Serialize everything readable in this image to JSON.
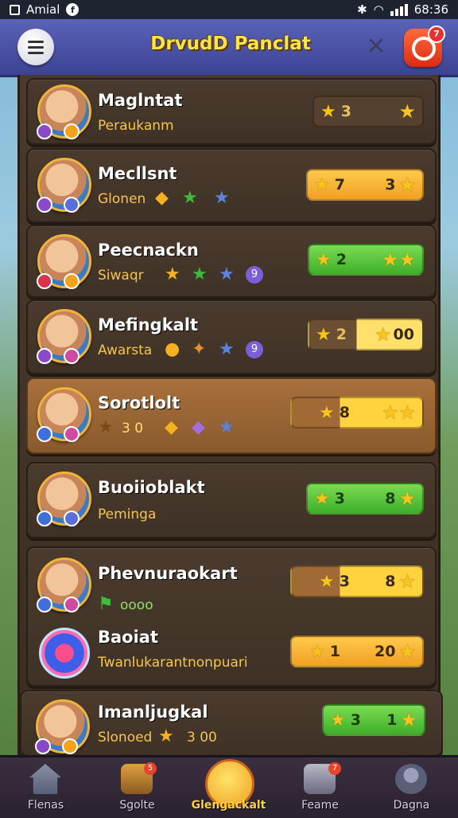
{
  "status_bar": {
    "app_name": "Amial",
    "time": "68:36"
  },
  "header": {
    "title": "DrvudD Panclat",
    "notification_count": "7"
  },
  "players": [
    {
      "name": "Maglntat",
      "subtitle": "Peraukanm",
      "stars_left": "3",
      "stars_right": "",
      "pill_style": "dark"
    },
    {
      "name": "Mecllsnt",
      "subtitle": "Glonen",
      "stars_left": "7",
      "stars_right": "3",
      "pill_style": "orange"
    },
    {
      "name": "Peecnackn",
      "subtitle": "Siwaqr",
      "stars_left": "2",
      "stars_right": "",
      "pill_style": "green"
    },
    {
      "name": "Mefingkalt",
      "subtitle": "Awarsta",
      "stars_left": "2",
      "stars_right": "00",
      "pill_style": "split"
    },
    {
      "name": "Sorotlolt",
      "subtitle": "3 0",
      "stars_left": "8",
      "stars_right": "",
      "pill_style": "split2"
    },
    {
      "name": "Buoiioblakt",
      "subtitle": "Peminga",
      "stars_left": "3",
      "stars_right": "8",
      "pill_style": "green"
    },
    {
      "name": "Phevnuraokart",
      "subtitle": "oooo",
      "stars_left": "3",
      "stars_right": "8",
      "pill_style": "split2"
    },
    {
      "name": "Baoiat",
      "subtitle": "Twanlukarantnonpuari",
      "stars_left": "1",
      "stars_right": "20",
      "pill_style": "orange"
    },
    {
      "name": "Imanljugkal",
      "subtitle": "Slonoed",
      "extra": "3 00",
      "stars_left": "3",
      "stars_right": "1",
      "pill_style": "green"
    }
  ],
  "nav": [
    {
      "label": "Flenas",
      "icon": "home-icon"
    },
    {
      "label": "Sgolte",
      "icon": "chest-icon",
      "badge": "5"
    },
    {
      "label": "Glengackalt",
      "icon": "smiley-icon"
    },
    {
      "label": "Feame",
      "icon": "box-icon",
      "badge": "7"
    },
    {
      "label": "Dagna",
      "icon": "profile-icon"
    }
  ],
  "colors": {
    "header": "#4a52a8",
    "panel": "#3f3126",
    "gold": "#f6b21e",
    "green": "#3fae2a",
    "orange": "#f0a024"
  }
}
